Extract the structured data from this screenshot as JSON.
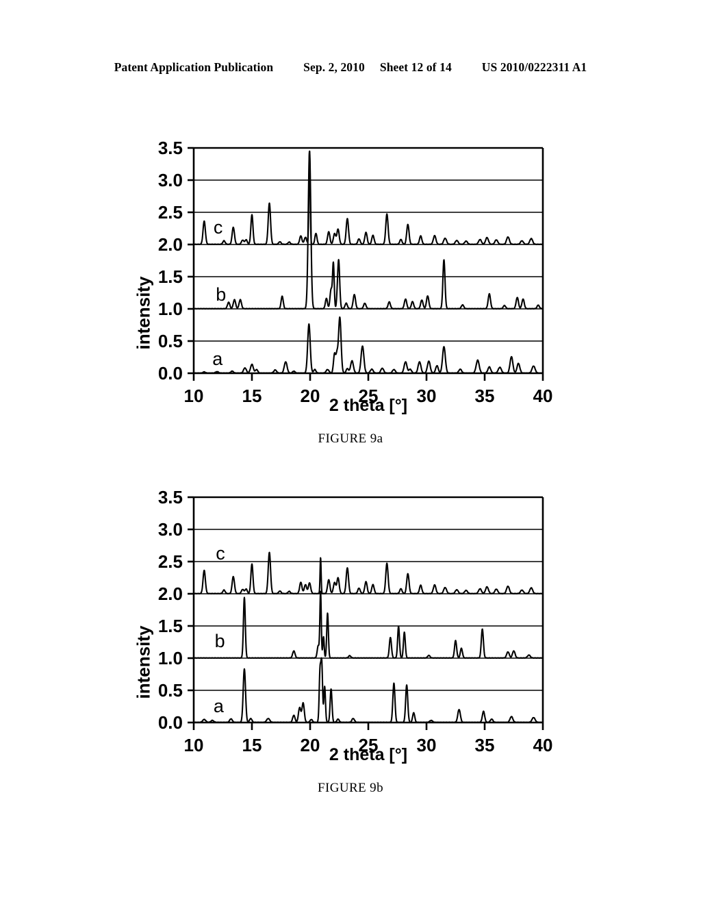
{
  "header": {
    "publication": "Patent Application Publication",
    "date": "Sep. 2, 2010",
    "sheet": "Sheet 12 of 14",
    "number": "US 2010/0222311 A1"
  },
  "figures": [
    {
      "id": "9a",
      "caption": "FIGURE 9a",
      "chart_data": {
        "type": "line",
        "title": "",
        "xlabel": "2 theta [°]",
        "ylabel": "intensity",
        "xlim": [
          10,
          40
        ],
        "ylim": [
          0.0,
          3.5
        ],
        "xticks": [
          10,
          15,
          20,
          25,
          30,
          35,
          40
        ],
        "xtick_labels": [
          "10",
          "15",
          "20",
          "25",
          "30",
          "35",
          "40"
        ],
        "yticks": [
          0.0,
          0.5,
          1.0,
          1.5,
          2.0,
          2.5,
          3.0,
          3.5
        ],
        "ytick_labels": [
          "0.0",
          "0.5",
          "1.0",
          "1.5",
          "2.0",
          "2.5",
          "3.0",
          "3.5"
        ],
        "grid": true,
        "legend": "none",
        "line_color": "#000000",
        "series": [
          {
            "name": "a",
            "label": "a",
            "label_x": 11.6,
            "label_y": 0.13,
            "offset": 0.0,
            "peaks": [
              [
                10.9,
                0.018,
                0.1
              ],
              [
                12.0,
                0.022,
                0.12
              ],
              [
                13.3,
                0.03,
                0.11
              ],
              [
                14.4,
                0.08,
                0.12
              ],
              [
                15.0,
                0.135,
                0.12
              ],
              [
                15.4,
                0.055,
                0.1
              ],
              [
                17.0,
                0.048,
                0.12
              ],
              [
                17.9,
                0.175,
                0.12
              ],
              [
                18.6,
                0.03,
                0.1
              ],
              [
                19.9,
                0.76,
                0.11
              ],
              [
                20.4,
                0.055,
                0.1
              ],
              [
                21.5,
                0.055,
                0.12
              ],
              [
                22.1,
                0.3,
                0.09
              ],
              [
                22.3,
                0.26,
                0.08
              ],
              [
                22.55,
                0.87,
                0.11
              ],
              [
                23.2,
                0.07,
                0.1
              ],
              [
                23.6,
                0.19,
                0.12
              ],
              [
                24.5,
                0.42,
                0.12
              ],
              [
                25.3,
                0.06,
                0.12
              ],
              [
                26.2,
                0.075,
                0.12
              ],
              [
                27.2,
                0.055,
                0.12
              ],
              [
                28.2,
                0.175,
                0.12
              ],
              [
                28.6,
                0.06,
                0.11
              ],
              [
                29.4,
                0.175,
                0.12
              ],
              [
                30.2,
                0.185,
                0.12
              ],
              [
                30.9,
                0.115,
                0.11
              ],
              [
                31.5,
                0.41,
                0.12
              ],
              [
                32.9,
                0.06,
                0.12
              ],
              [
                34.4,
                0.2,
                0.13
              ],
              [
                35.4,
                0.095,
                0.12
              ],
              [
                36.3,
                0.09,
                0.13
              ],
              [
                37.3,
                0.255,
                0.12
              ],
              [
                37.9,
                0.15,
                0.12
              ],
              [
                39.2,
                0.11,
                0.13
              ]
            ]
          },
          {
            "name": "b",
            "label": "b",
            "label_x": 11.9,
            "label_y": 1.13,
            "offset": 1.0,
            "peaks": [
              [
                13.0,
                0.1,
                0.1
              ],
              [
                13.5,
                0.14,
                0.1
              ],
              [
                14.0,
                0.14,
                0.1
              ],
              [
                17.6,
                0.195,
                0.09
              ],
              [
                19.95,
                2.45,
                0.11
              ],
              [
                21.4,
                0.16,
                0.09
              ],
              [
                21.8,
                0.3,
                0.09
              ],
              [
                22.0,
                0.7,
                0.07
              ],
              [
                22.3,
                0.06,
                0.05
              ],
              [
                22.45,
                0.76,
                0.09
              ],
              [
                23.1,
                0.085,
                0.1
              ],
              [
                23.8,
                0.22,
                0.1
              ],
              [
                24.7,
                0.085,
                0.1
              ],
              [
                26.8,
                0.105,
                0.1
              ],
              [
                28.2,
                0.15,
                0.1
              ],
              [
                28.8,
                0.11,
                0.1
              ],
              [
                29.6,
                0.135,
                0.1
              ],
              [
                30.1,
                0.2,
                0.1
              ],
              [
                31.5,
                0.76,
                0.09
              ],
              [
                33.1,
                0.06,
                0.1
              ],
              [
                35.4,
                0.23,
                0.1
              ],
              [
                36.7,
                0.05,
                0.1
              ],
              [
                37.8,
                0.175,
                0.1
              ],
              [
                38.3,
                0.15,
                0.1
              ],
              [
                39.6,
                0.055,
                0.1
              ]
            ]
          },
          {
            "name": "c",
            "label": "c",
            "label_x": 11.7,
            "label_y": 2.17,
            "offset": 2.0,
            "peaks": [
              [
                10.9,
                0.36,
                0.1
              ],
              [
                12.6,
                0.055,
                0.1
              ],
              [
                13.4,
                0.265,
                0.1
              ],
              [
                14.2,
                0.065,
                0.1
              ],
              [
                14.5,
                0.07,
                0.1
              ],
              [
                15.0,
                0.46,
                0.09
              ],
              [
                16.5,
                0.64,
                0.1
              ],
              [
                17.4,
                0.04,
                0.1
              ],
              [
                18.2,
                0.035,
                0.1
              ],
              [
                19.2,
                0.13,
                0.1
              ],
              [
                19.6,
                0.11,
                0.1
              ],
              [
                19.95,
                1.45,
                0.055
              ],
              [
                20.5,
                0.17,
                0.09
              ],
              [
                21.6,
                0.195,
                0.1
              ],
              [
                22.1,
                0.165,
                0.1
              ],
              [
                22.4,
                0.235,
                0.1
              ],
              [
                23.2,
                0.4,
                0.1
              ],
              [
                24.2,
                0.085,
                0.1
              ],
              [
                24.8,
                0.185,
                0.1
              ],
              [
                25.4,
                0.14,
                0.1
              ],
              [
                26.6,
                0.47,
                0.1
              ],
              [
                27.8,
                0.075,
                0.1
              ],
              [
                28.4,
                0.31,
                0.1
              ],
              [
                29.5,
                0.13,
                0.1
              ],
              [
                30.7,
                0.135,
                0.11
              ],
              [
                31.6,
                0.095,
                0.12
              ],
              [
                32.6,
                0.06,
                0.12
              ],
              [
                33.4,
                0.05,
                0.12
              ],
              [
                34.6,
                0.075,
                0.12
              ],
              [
                35.2,
                0.105,
                0.12
              ],
              [
                36.0,
                0.07,
                0.12
              ],
              [
                37.0,
                0.115,
                0.12
              ],
              [
                38.2,
                0.055,
                0.12
              ],
              [
                39.0,
                0.09,
                0.12
              ]
            ]
          }
        ]
      }
    },
    {
      "id": "9b",
      "caption": "FIGURE 9b",
      "chart_data": {
        "type": "line",
        "title": "",
        "xlabel": "2 theta [°]",
        "ylabel": "intensity",
        "xlim": [
          10,
          40
        ],
        "ylim": [
          0.0,
          3.5
        ],
        "xticks": [
          10,
          15,
          20,
          25,
          30,
          35,
          40
        ],
        "xtick_labels": [
          "10",
          "15",
          "20",
          "25",
          "30",
          "35",
          "40"
        ],
        "yticks": [
          0.0,
          0.5,
          1.0,
          1.5,
          2.0,
          2.5,
          3.0,
          3.5
        ],
        "ytick_labels": [
          "0.0",
          "0.5",
          "1.0",
          "1.5",
          "2.0",
          "2.5",
          "3.0",
          "3.5"
        ],
        "grid": true,
        "legend": "none",
        "line_color": "#000000",
        "series": [
          {
            "name": "a",
            "label": "a",
            "label_x": 11.7,
            "label_y": 0.16,
            "offset": 0.0,
            "peaks": [
              [
                10.9,
                0.045,
                0.13
              ],
              [
                11.6,
                0.03,
                0.12
              ],
              [
                13.2,
                0.055,
                0.11
              ],
              [
                14.35,
                0.83,
                0.1
              ],
              [
                14.9,
                0.06,
                0.1
              ],
              [
                16.4,
                0.06,
                0.13
              ],
              [
                18.6,
                0.11,
                0.1
              ],
              [
                19.1,
                0.23,
                0.1
              ],
              [
                19.4,
                0.3,
                0.1
              ],
              [
                20.1,
                0.045,
                0.1
              ],
              [
                20.85,
                0.78,
                0.07
              ],
              [
                21.0,
                0.9,
                0.07
              ],
              [
                21.25,
                0.56,
                0.07
              ],
              [
                21.8,
                0.52,
                0.08
              ],
              [
                22.4,
                0.05,
                0.1
              ],
              [
                23.7,
                0.06,
                0.11
              ],
              [
                27.2,
                0.61,
                0.09
              ],
              [
                28.3,
                0.58,
                0.09
              ],
              [
                28.9,
                0.15,
                0.09
              ],
              [
                30.4,
                0.03,
                0.12
              ],
              [
                32.8,
                0.2,
                0.11
              ],
              [
                34.9,
                0.17,
                0.1
              ],
              [
                35.6,
                0.05,
                0.11
              ],
              [
                37.3,
                0.09,
                0.12
              ],
              [
                39.2,
                0.075,
                0.13
              ]
            ]
          },
          {
            "name": "b",
            "label": "b",
            "label_x": 11.8,
            "label_y": 1.17,
            "offset": 1.0,
            "peaks": [
              [
                14.35,
                0.94,
                0.08
              ],
              [
                18.6,
                0.11,
                0.1
              ],
              [
                20.7,
                0.19,
                0.09
              ],
              [
                20.9,
                1.02,
                0.06
              ],
              [
                21.15,
                0.33,
                0.06
              ],
              [
                21.5,
                0.7,
                0.07
              ],
              [
                23.4,
                0.035,
                0.1
              ],
              [
                26.9,
                0.32,
                0.09
              ],
              [
                27.6,
                0.49,
                0.08
              ],
              [
                28.1,
                0.4,
                0.08
              ],
              [
                30.2,
                0.04,
                0.1
              ],
              [
                32.5,
                0.27,
                0.09
              ],
              [
                33.0,
                0.15,
                0.09
              ],
              [
                34.8,
                0.45,
                0.09
              ],
              [
                37.0,
                0.095,
                0.11
              ],
              [
                37.5,
                0.11,
                0.11
              ],
              [
                38.8,
                0.045,
                0.12
              ]
            ]
          },
          {
            "name": "c",
            "label": "c",
            "label_x": 11.9,
            "label_y": 2.53,
            "offset": 2.0,
            "peaks": [
              [
                10.9,
                0.36,
                0.1
              ],
              [
                12.6,
                0.055,
                0.1
              ],
              [
                13.4,
                0.265,
                0.1
              ],
              [
                14.2,
                0.065,
                0.1
              ],
              [
                14.5,
                0.07,
                0.1
              ],
              [
                15.0,
                0.46,
                0.09
              ],
              [
                16.5,
                0.64,
                0.1
              ],
              [
                17.4,
                0.04,
                0.1
              ],
              [
                18.2,
                0.035,
                0.1
              ],
              [
                19.2,
                0.175,
                0.1
              ],
              [
                19.6,
                0.14,
                0.1
              ],
              [
                19.95,
                0.165,
                0.1
              ],
              [
                20.9,
                0.56,
                0.045
              ],
              [
                21.6,
                0.215,
                0.1
              ],
              [
                22.1,
                0.17,
                0.1
              ],
              [
                22.4,
                0.245,
                0.1
              ],
              [
                23.2,
                0.4,
                0.1
              ],
              [
                24.2,
                0.085,
                0.1
              ],
              [
                24.8,
                0.185,
                0.1
              ],
              [
                25.4,
                0.14,
                0.1
              ],
              [
                26.6,
                0.47,
                0.1
              ],
              [
                27.8,
                0.075,
                0.1
              ],
              [
                28.4,
                0.31,
                0.1
              ],
              [
                29.5,
                0.13,
                0.1
              ],
              [
                30.7,
                0.135,
                0.11
              ],
              [
                31.6,
                0.095,
                0.12
              ],
              [
                32.6,
                0.06,
                0.12
              ],
              [
                33.4,
                0.05,
                0.12
              ],
              [
                34.6,
                0.075,
                0.12
              ],
              [
                35.2,
                0.105,
                0.12
              ],
              [
                36.0,
                0.07,
                0.12
              ],
              [
                37.0,
                0.115,
                0.12
              ],
              [
                38.2,
                0.055,
                0.12
              ],
              [
                39.0,
                0.09,
                0.12
              ]
            ]
          }
        ]
      }
    }
  ]
}
